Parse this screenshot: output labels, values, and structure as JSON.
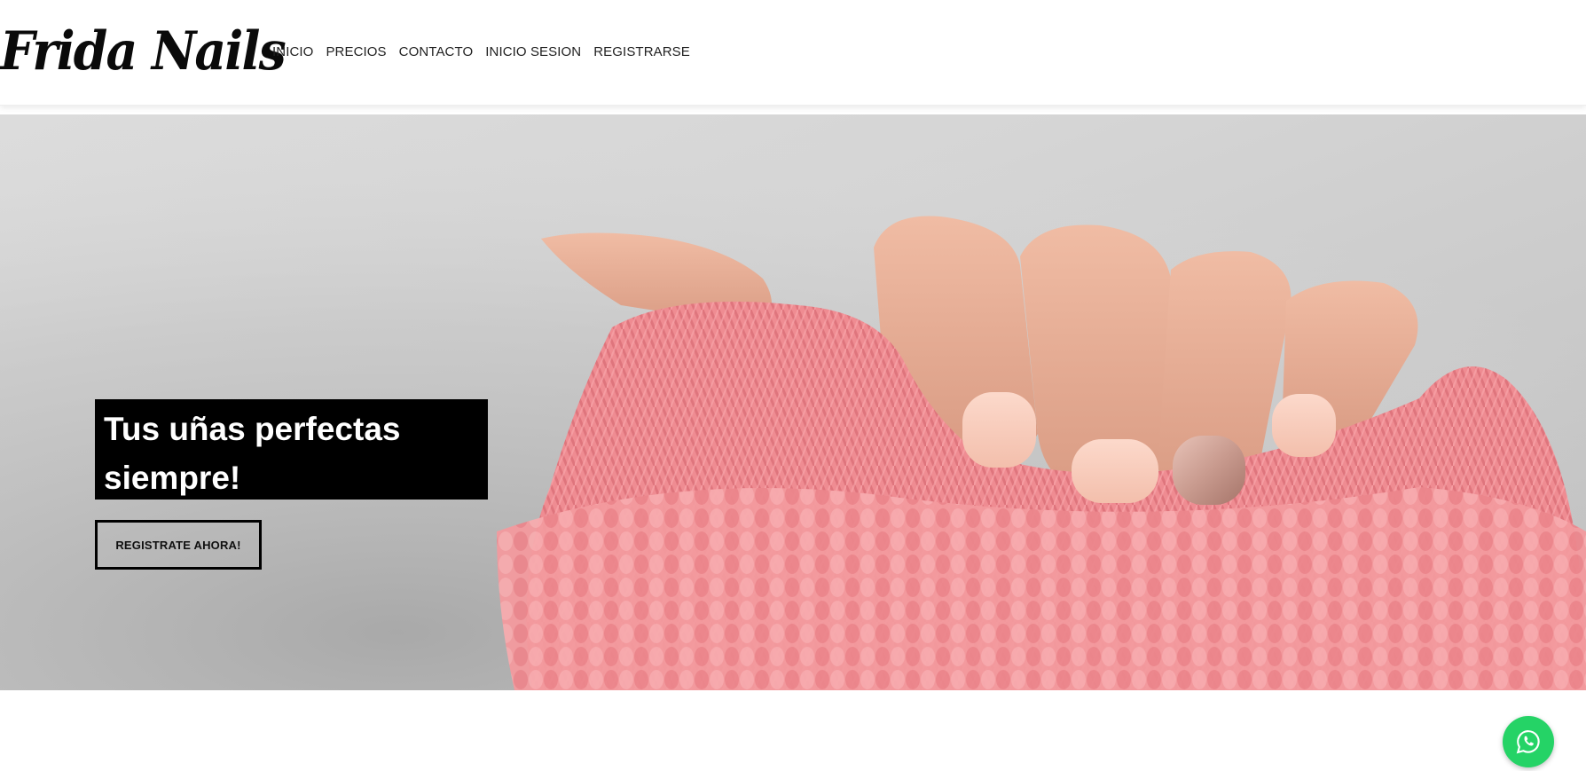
{
  "brand": {
    "name": "Frida Nails"
  },
  "nav": {
    "items": [
      {
        "label": "INICIO"
      },
      {
        "label": "PRECIOS"
      },
      {
        "label": "CONTACTO"
      },
      {
        "label": "INICIO SESION"
      },
      {
        "label": "REGISTRARSE"
      }
    ]
  },
  "hero": {
    "title": "Tus uñas perfectas siempre!",
    "cta_label": "REGISTRATE AHORA!",
    "image": "hand-with-manicured-nails-in-pink-knit-sweater"
  },
  "floating": {
    "icon": "whatsapp-icon"
  },
  "colors": {
    "accent_whatsapp": "#25d366",
    "title_box": "#000000",
    "sweater": "#f08f95",
    "nail": "#f5c9b8"
  }
}
